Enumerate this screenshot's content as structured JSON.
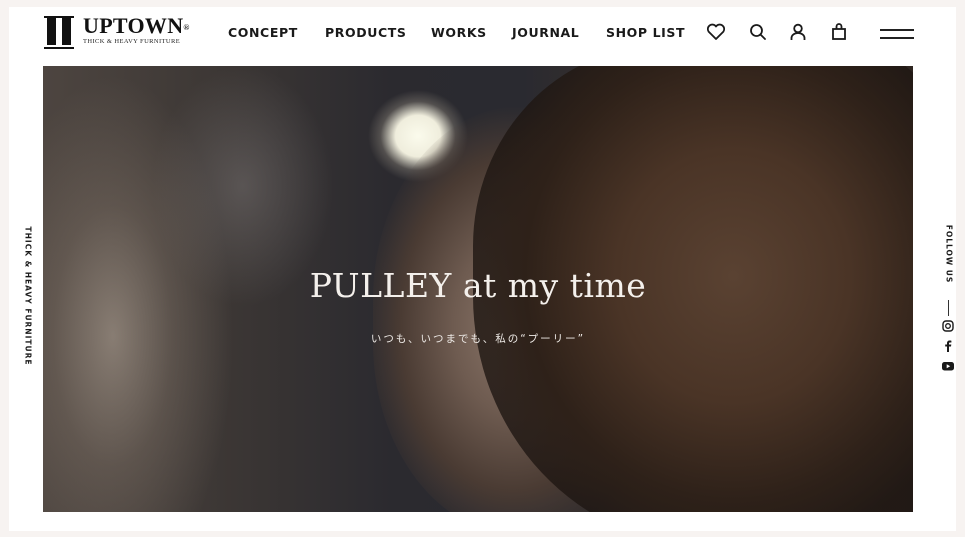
{
  "header": {
    "brand": "UPTOWN",
    "brand_mark": "®",
    "tagline": "THICK & HEAVY FURNITURE",
    "nav": [
      {
        "label": "CONCEPT"
      },
      {
        "label": "PRODUCTS"
      },
      {
        "label": "WORKS"
      },
      {
        "label": "JOURNAL"
      },
      {
        "label": "SHOP LIST"
      }
    ],
    "icons": [
      "heart-icon",
      "search-icon",
      "user-icon",
      "shopping-bag-icon",
      "menu-icon"
    ]
  },
  "hero": {
    "title": "PULLEY at my time",
    "subtitle": "いつも、いつまでも、私の“プーリー”"
  },
  "side": {
    "left_text": "THICK & HEAVY FURNITURE",
    "right_text": "FOLLOW US",
    "social": [
      "instagram-icon",
      "facebook-icon",
      "youtube-icon"
    ]
  },
  "colors": {
    "background": "#f7f3f1",
    "text": "#1a1a1a",
    "hero_text": "#f4f0ec"
  }
}
